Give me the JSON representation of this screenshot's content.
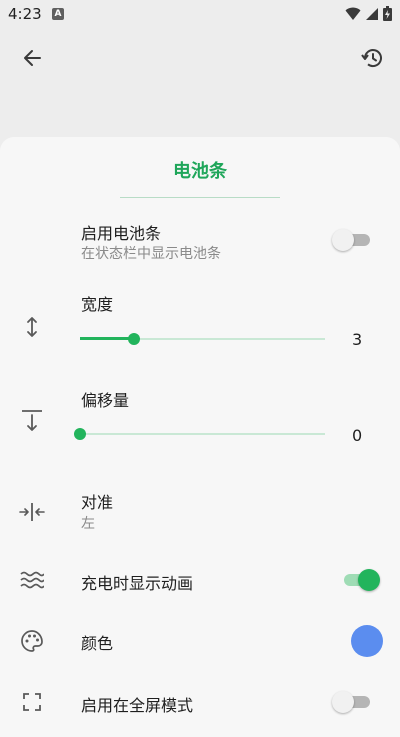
{
  "status_bar": {
    "time": "4:23",
    "notification_badge": "A"
  },
  "top_bar": {
    "back_icon": "arrow-back-icon",
    "reset_icon": "restore-icon"
  },
  "sheet": {
    "title": "电池条",
    "enable": {
      "title": "启用电池条",
      "subtitle": "在状态栏中显示电池条",
      "checked": false
    },
    "width": {
      "title": "宽度",
      "value": "3",
      "fraction": 0.22
    },
    "offset": {
      "title": "偏移量",
      "value": "0",
      "fraction": 0.0
    },
    "align": {
      "title": "对准",
      "value": "左"
    },
    "charge_anim": {
      "title": "充电时显示动画",
      "checked": true
    },
    "color": {
      "title": "颜色",
      "value": "#5b8def"
    },
    "fullscreen": {
      "title": "启用在全屏模式",
      "checked": false
    }
  },
  "colors": {
    "accent": "#22b45c",
    "title_green": "#1fa65a"
  }
}
